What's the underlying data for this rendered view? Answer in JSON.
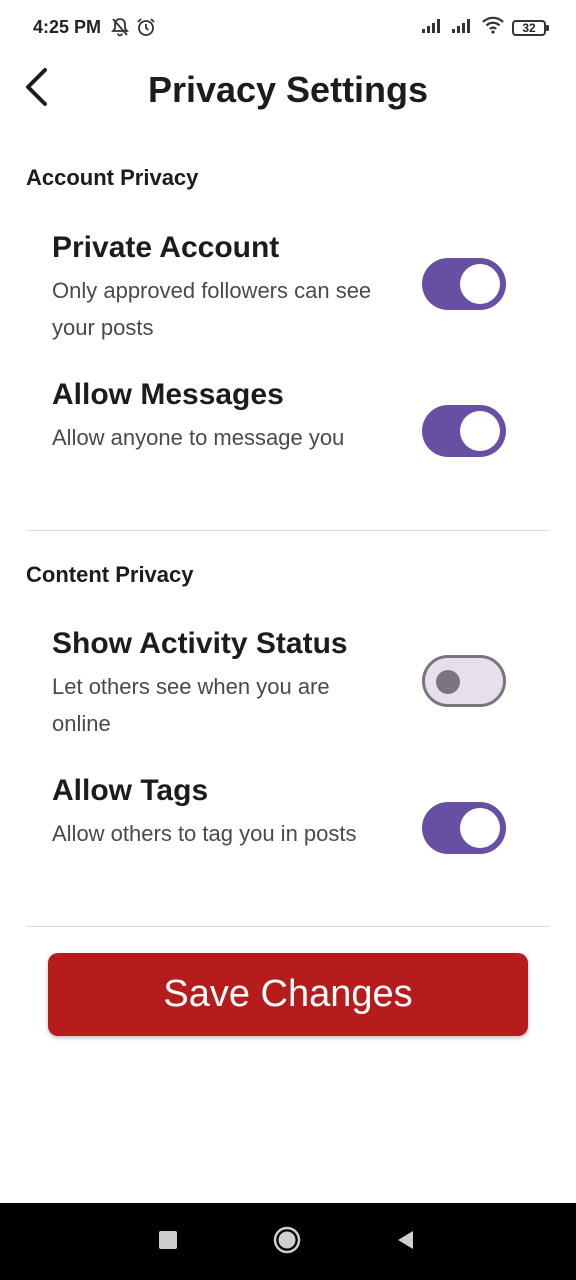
{
  "status_bar": {
    "time": "4:25 PM",
    "battery": "32",
    "icons": [
      "bell-off-icon",
      "alarm-icon",
      "signal-icon",
      "signal-icon",
      "wifi-icon",
      "battery-icon"
    ]
  },
  "header": {
    "title": "Privacy Settings",
    "back_icon": "chevron-left-icon"
  },
  "sections": [
    {
      "title": "Account Privacy",
      "settings": [
        {
          "title": "Private Account",
          "description": "Only approved followers can see your posts",
          "enabled": true
        },
        {
          "title": "Allow Messages",
          "description": "Allow anyone to message you",
          "enabled": true
        }
      ]
    },
    {
      "title": "Content Privacy",
      "settings": [
        {
          "title": "Show Activity Status",
          "description": "Let others see when you are online",
          "enabled": false
        },
        {
          "title": "Allow Tags",
          "description": "Allow others to tag you in posts",
          "enabled": true
        }
      ]
    }
  ],
  "save_button": {
    "label": "Save Changes"
  },
  "colors": {
    "toggle_on": "#6750a4",
    "toggle_off_track": "#e7e0ec",
    "toggle_off_border": "#79747e",
    "save_button": "#b71c1c"
  },
  "nav_bar": {
    "icons": [
      "square-icon",
      "circle-home-icon",
      "triangle-back-icon"
    ]
  }
}
